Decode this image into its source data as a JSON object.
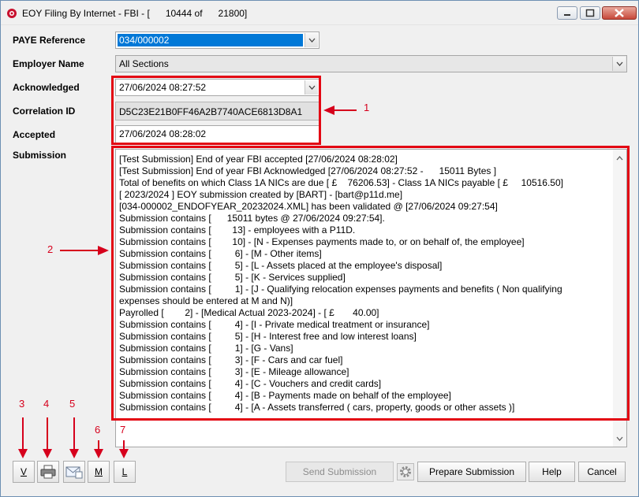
{
  "window": {
    "title": "EOY Filing By Internet - FBI - [      10444 of      21800]"
  },
  "form": {
    "paye_reference": {
      "label": "PAYE Reference",
      "value": "034/000002"
    },
    "employer_name": {
      "label": "Employer Name",
      "value": "All Sections"
    },
    "acknowledged": {
      "label": "Acknowledged",
      "value": "27/06/2024 08:27:52"
    },
    "correlation_id": {
      "label": "Correlation ID",
      "value": "D5C23E21B0FF46A2B7740ACE6813D8A1"
    },
    "accepted": {
      "label": "Accepted",
      "value": "27/06/2024 08:28:02"
    },
    "submission": {
      "label": "Submission"
    }
  },
  "submission_lines": [
    "[Test Submission] End of year FBI accepted [27/06/2024 08:28:02]",
    "[Test Submission] End of year FBI Acknowledged [27/06/2024 08:27:52 -      15011 Bytes ]",
    "Total of benefits on which Class 1A NICs are due [ £    76206.53] - Class 1A NICs payable [ £     10516.50]",
    "[ 2023/2024 ] EOY submission created by [BART] - [bart@p11d.me]",
    "[034-000002_ENDOFYEAR_20232024.XML] has been validated @ [27/06/2024 09:27:54]",
    "Submission contains [      15011 bytes @ 27/06/2024 09:27:54].",
    "Submission contains [        13] - employees with a P11D.",
    "Submission contains [        10] - [N - Expenses payments made to, or on behalf of, the employee]",
    "Submission contains [         6] - [M - Other items]",
    "Submission contains [         5] - [L - Assets placed at the employee's disposal]",
    "Submission contains [         5] - [K - Services supplied]",
    "Submission contains [         1] - [J - Qualifying relocation expenses payments and benefits ( Non qualifying",
    "expenses should be entered at M and N)]",
    "Payrolled [        2] - [Medical Actual 2023-2024] - [ £       40.00]",
    "Submission contains [         4] - [I - Private medical treatment or insurance]",
    "Submission contains [         5] - [H - Interest free and low interest loans]",
    "Submission contains [         1] - [G - Vans]",
    "Submission contains [         3] - [F - Cars and car fuel]",
    "Submission contains [         3] - [E - Mileage allowance]",
    "Submission contains [         4] - [C - Vouchers and credit cards]",
    "Submission contains [         4] - [B - Payments made on behalf of the employee]",
    "Submission contains [         4] - [A - Assets transferred ( cars, property, goods or other assets )]"
  ],
  "annotations": {
    "n1": "1",
    "n2": "2",
    "n3": "3",
    "n4": "4",
    "n5": "5",
    "n6": "6",
    "n7": "7"
  },
  "toolbar": {
    "v_label": "V",
    "print_icon": "printer-icon",
    "email_icon": "email-icon",
    "m_label": "M",
    "l_label": "L"
  },
  "buttons": {
    "send_submission": "Send Submission",
    "prepare_submission": "Prepare Submission",
    "help": "Help",
    "cancel": "Cancel"
  },
  "colors": {
    "annotation_red": "#e30613",
    "selection_blue": "#0078d7"
  }
}
